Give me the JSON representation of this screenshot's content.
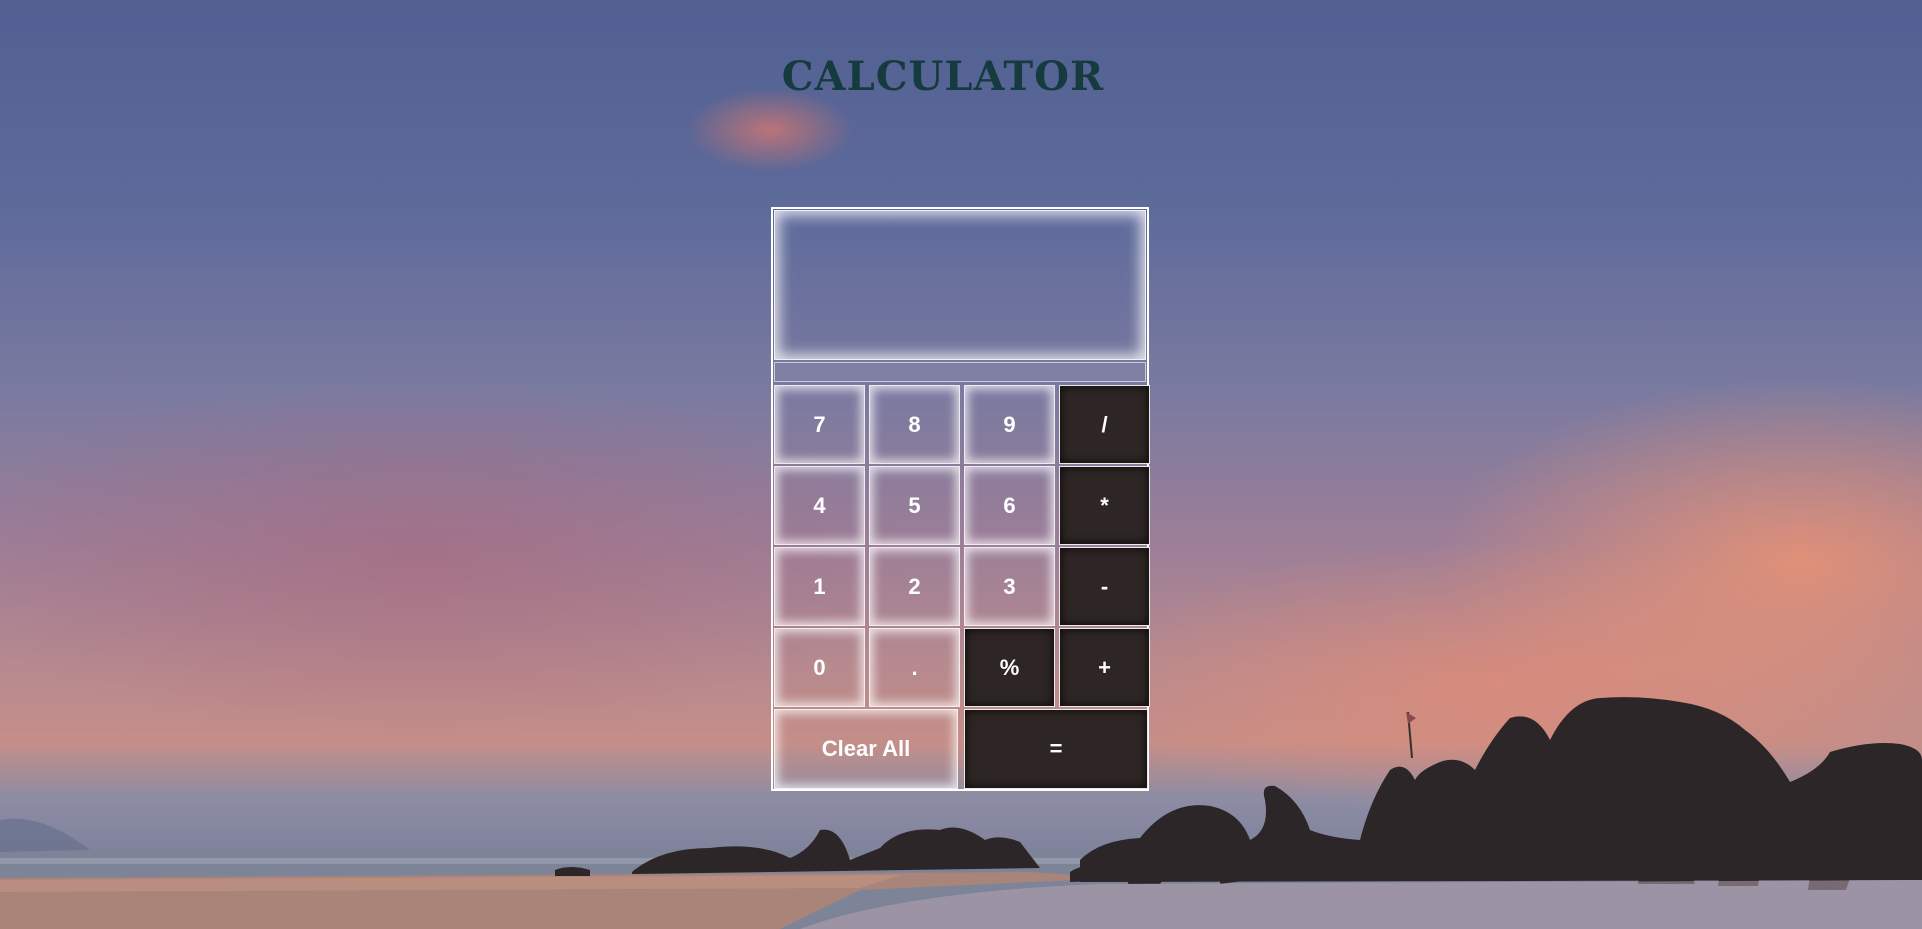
{
  "page": {
    "title": "CALCULATOR"
  },
  "display": {
    "value": ""
  },
  "keys": {
    "seven": "7",
    "eight": "8",
    "nine": "9",
    "divide": "/",
    "four": "4",
    "five": "5",
    "six": "6",
    "multiply": "*",
    "one": "1",
    "two": "2",
    "three": "3",
    "subtract": "-",
    "zero": "0",
    "decimal": ".",
    "percent": "%",
    "add": "+",
    "clear_all": "Clear All",
    "equals": "="
  },
  "colors": {
    "title": "#153b3f",
    "operator_key": "#2d2624",
    "key_text": "#ffffff"
  }
}
